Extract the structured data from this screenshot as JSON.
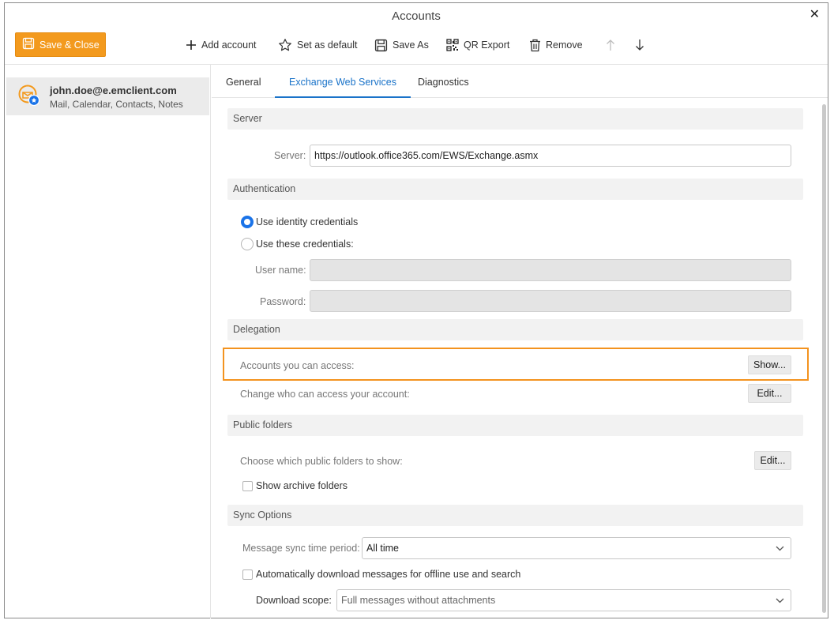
{
  "window": {
    "title": "Accounts"
  },
  "toolbar": {
    "save_close": "Save & Close",
    "add_account": "Add account",
    "set_default": "Set as default",
    "save_as": "Save As",
    "qr_export": "QR Export",
    "remove": "Remove"
  },
  "sidebar": {
    "account": {
      "email": "john.doe@e.emclient.com",
      "services": "Mail, Calendar, Contacts, Notes"
    }
  },
  "tabs": [
    {
      "label": "General"
    },
    {
      "label": "Exchange Web Services"
    },
    {
      "label": "Diagnostics"
    }
  ],
  "server": {
    "header": "Server",
    "server_label": "Server:",
    "server_value": "https://outlook.office365.com/EWS/Exchange.asmx"
  },
  "authentication": {
    "header": "Authentication",
    "use_identity": "Use identity credentials",
    "use_these": "Use these credentials:",
    "username_label": "User name:",
    "password_label": "Password:"
  },
  "delegation": {
    "header": "Delegation",
    "accounts_access_label": "Accounts you can access:",
    "show_button": "Show...",
    "change_access_label": "Change who can access your account:",
    "edit_button": "Edit..."
  },
  "public_folders": {
    "header": "Public folders",
    "choose_label": "Choose which public folders to show:",
    "edit_button": "Edit...",
    "show_archive": "Show archive folders"
  },
  "sync": {
    "header": "Sync Options",
    "period_label": "Message sync time period:",
    "period_value": "All time",
    "auto_download": "Automatically download messages for offline use and search",
    "scope_label": "Download scope:",
    "scope_value": "Full messages without attachments"
  },
  "colors": {
    "accent": "#1a73c9",
    "save_button": "#f39a1e",
    "highlight": "#f3931f"
  }
}
